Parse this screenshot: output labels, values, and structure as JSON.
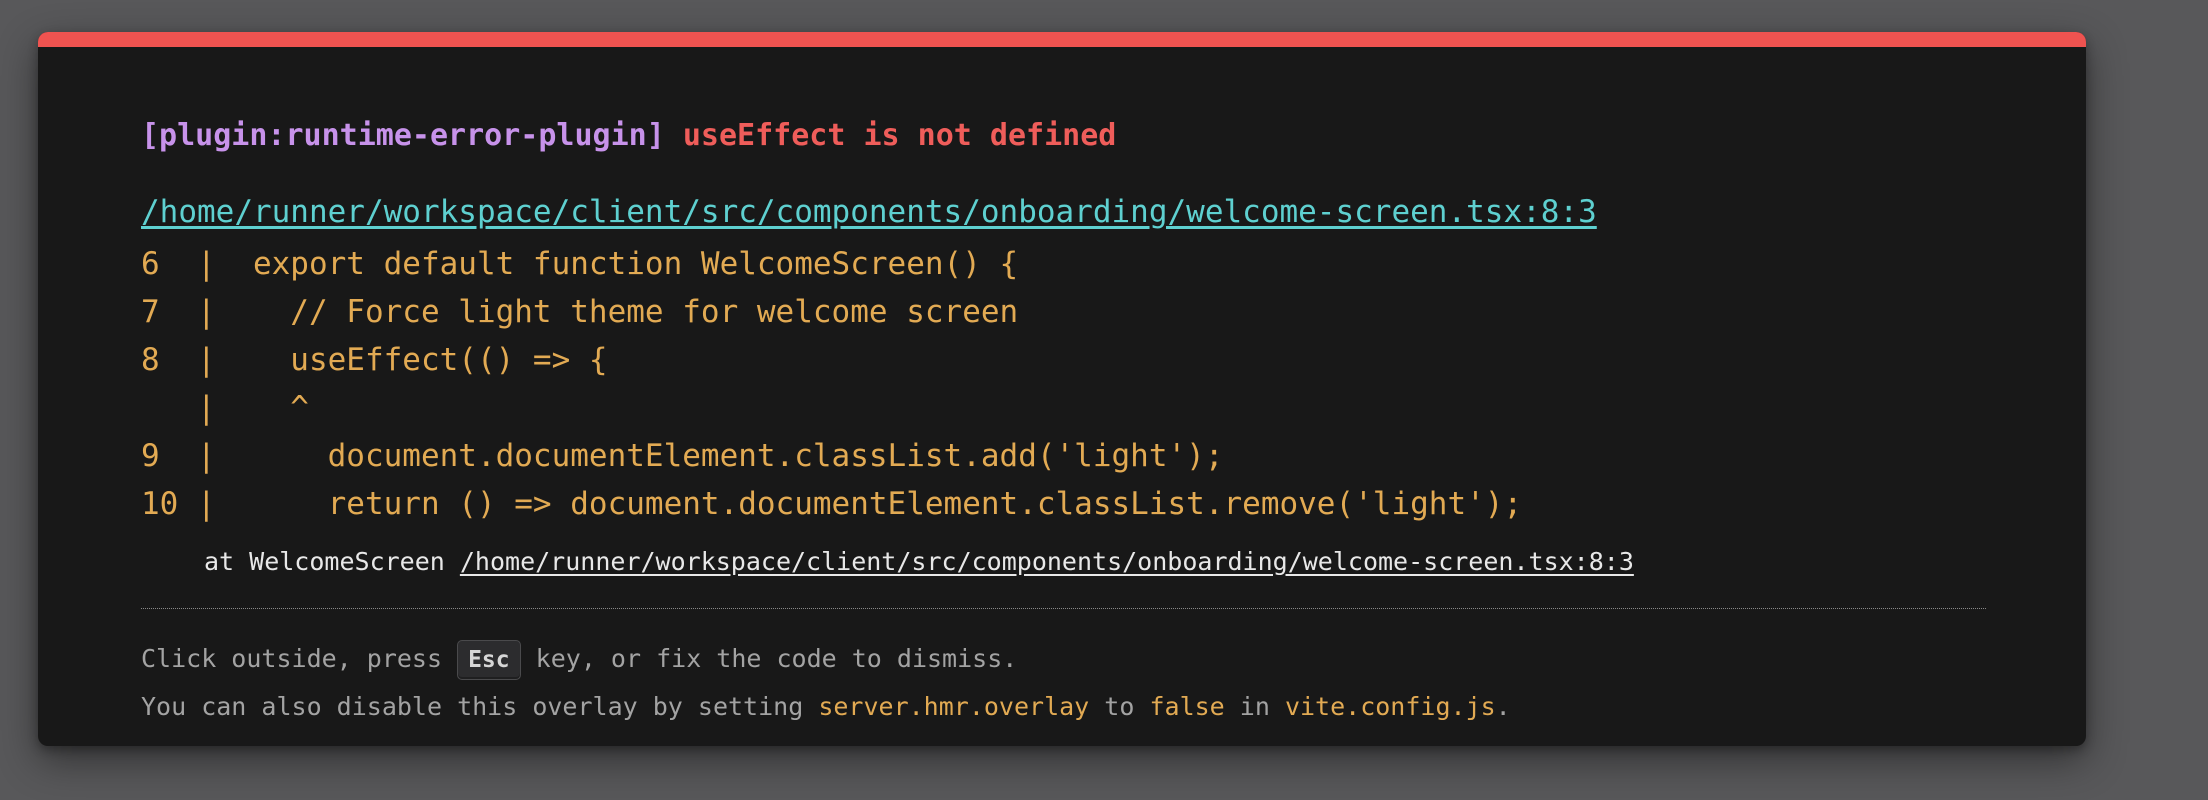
{
  "error": {
    "plugin": "[plugin:runtime-error-plugin]",
    "message": "useEffect is not defined",
    "file": "/home/runner/workspace/client/src/components/onboarding/welcome-screen.tsx:8:3"
  },
  "code_frame": [
    "6  |  export default function WelcomeScreen() {",
    "7  |    // Force light theme for welcome screen",
    "8  |    useEffect(() => {",
    "   |    ^",
    "9  |      document.documentElement.classList.add('light');",
    "10 |      return () => document.documentElement.classList.remove('light');"
  ],
  "stack": {
    "prefix": "at WelcomeScreen ",
    "location": "/home/runner/workspace/client/src/components/onboarding/welcome-screen.tsx:8:3"
  },
  "tip": {
    "line1_before": "Click outside, press ",
    "key": "Esc",
    "line1_after": " key, or fix the code to dismiss.",
    "line2_prefix": "You can also disable this overlay by setting ",
    "config_key": "server.hmr.overlay",
    "line2_to": " to ",
    "config_value": "false",
    "line2_in": " in ",
    "config_file": "vite.config.js",
    "line2_end": "."
  },
  "colors": {
    "accent": "#ef5350",
    "plugin": "#c792ea",
    "error": "#ef5d5a",
    "link": "#5ed0d0",
    "code": "#e2aa53"
  }
}
